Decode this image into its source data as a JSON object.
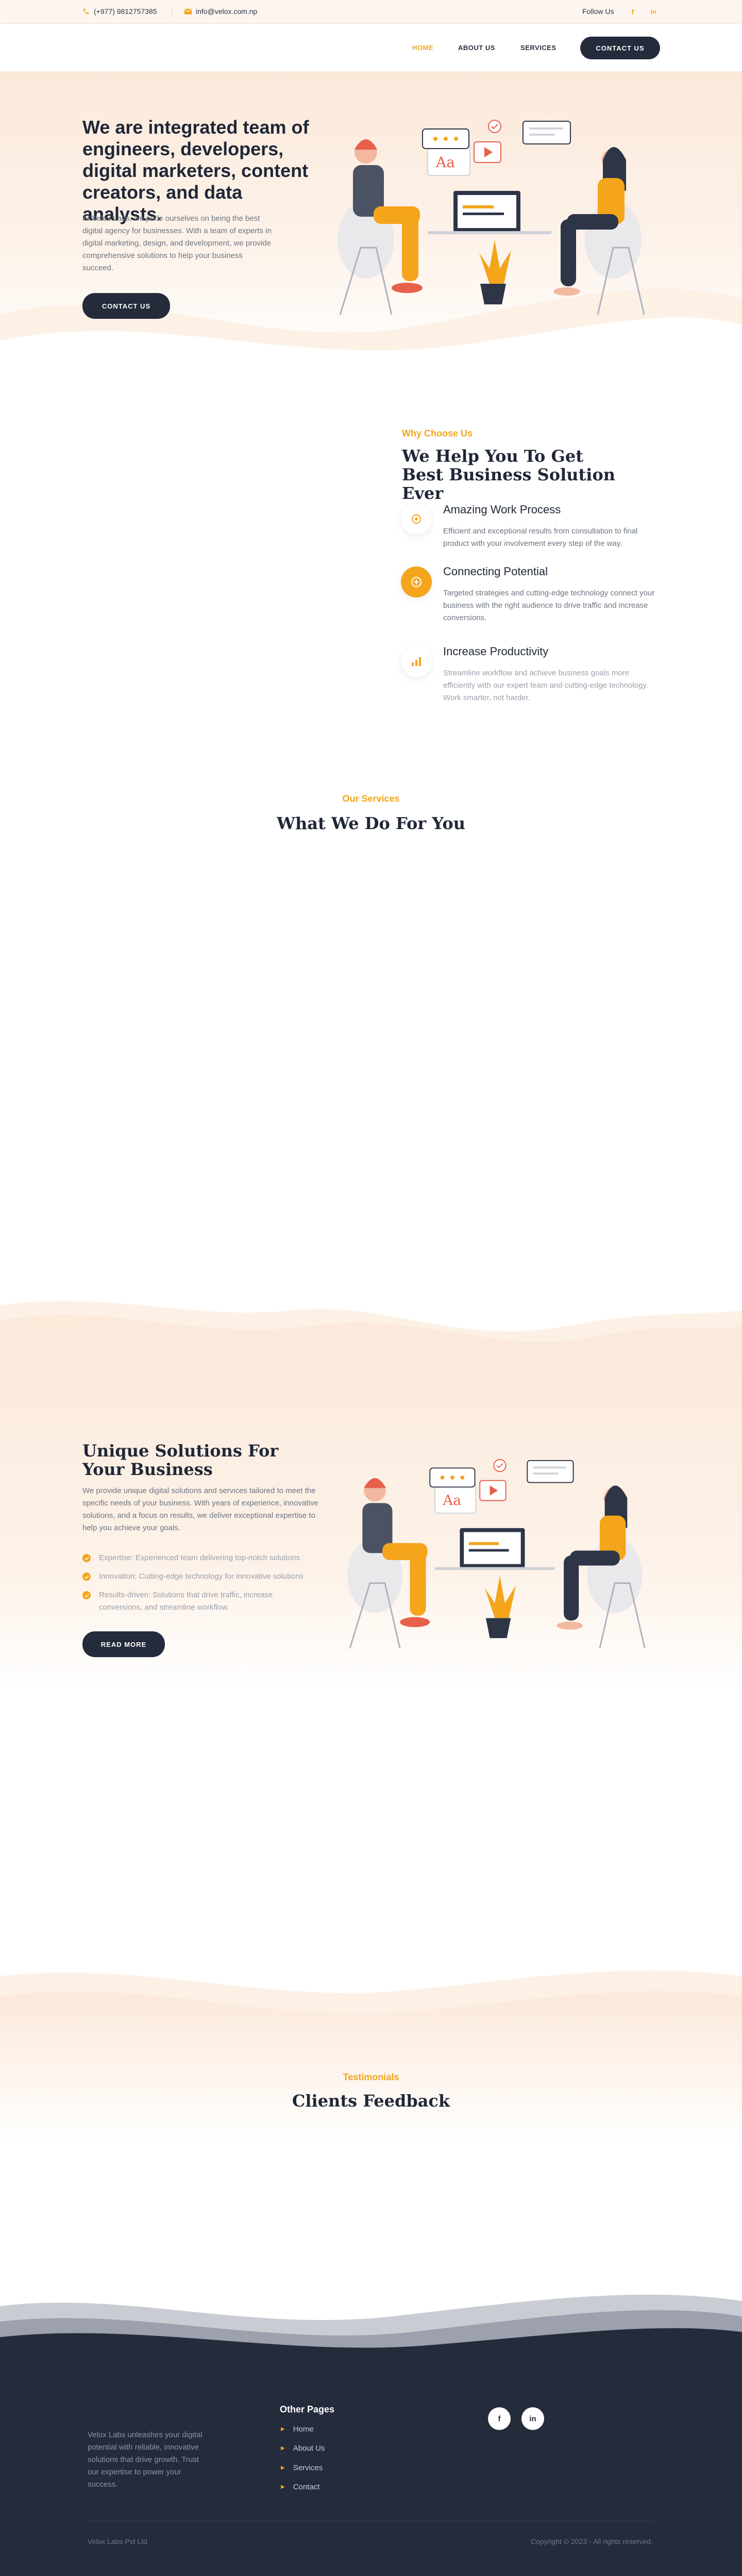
{
  "topbar": {
    "phone": "(+977) 9812757385",
    "email": "info@velox.com.np",
    "follow_label": "Follow Us",
    "social": [
      {
        "icon": "facebook-icon",
        "text": "f"
      },
      {
        "icon": "linkedin-icon",
        "text": "in"
      }
    ]
  },
  "nav": {
    "items": [
      "HOME",
      "ABOUT US",
      "SERVICES"
    ],
    "cta": "CONTACT US"
  },
  "hero": {
    "title": "We are integrated team of engineers, developers, digital marketers, content creators, and data analysts.",
    "text": "At Velox Labs, we pride ourselves on being the best digital agency for businesses. With a team of experts in digital marketing, design, and development, we provide comprehensive solutions to help your business succeed.",
    "cta": "CONTACT US"
  },
  "why": {
    "eyebrow": "Why Choose Us",
    "title": "We Help You To Get Best Business Solution Ever",
    "features": [
      {
        "title": "Amazing Work Process",
        "desc": "Efficient and exceptional results from consultation to final product with your involvement every step of the way."
      },
      {
        "title": "Connecting Potential",
        "desc": "Targeted strategies and cutting-edge technology connect your business with the right audience to drive traffic and increase conversions."
      },
      {
        "title": "Increase Productivity",
        "desc": "Streamline workflow and achieve business goals more efficiently with our expert team and cutting-edge technology. Work smarter, not harder."
      }
    ]
  },
  "services": {
    "eyebrow": "Our Services",
    "title": "What We Do For You"
  },
  "unique": {
    "title": "Unique Solutions For Your Business",
    "text": "We provide unique digital solutions and services tailored to meet the specific needs of your business. With years of experience, innovative solutions, and a focus on results, we deliver exceptional expertise to help you achieve your goals.",
    "points": [
      "Expertise: Experienced team delivering top-notch solutions",
      "Innovation: Cutting-edge technology for innovative solutions",
      "Results-driven: Solutions that drive traffic, increase conversions, and streamline workflow."
    ],
    "cta": "READ MORE"
  },
  "testimonials": {
    "eyebrow": "Testimonials",
    "title": "Clients Feedback"
  },
  "footer": {
    "about": "Velox Labs unleashes your digital potential with reliable, innovative solutions that drive growth. Trust our expertise to power your success.",
    "other_title": "Other Pages",
    "links": [
      "Home",
      "About Us",
      "Services",
      "Contact"
    ],
    "social": [
      {
        "icon": "facebook-icon",
        "text": "f"
      },
      {
        "icon": "linkedin-icon",
        "text": "in"
      }
    ],
    "company": "Velox Labs Pvt Ltd",
    "copyright": "Copyright © 2023 - All rights reserved."
  },
  "colors": {
    "accent": "#f4a51c",
    "dark": "#242b3b",
    "cream": "#fbe9da"
  }
}
